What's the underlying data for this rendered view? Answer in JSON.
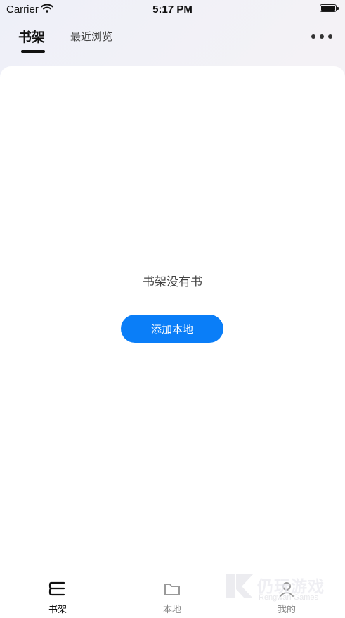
{
  "status_bar": {
    "carrier": "Carrier",
    "time": "5:17 PM"
  },
  "header": {
    "tabs": [
      {
        "label": "书架",
        "active": true
      },
      {
        "label": "最近浏览",
        "active": false
      }
    ],
    "more_icon": "more-horizontal-icon"
  },
  "main": {
    "empty_message": "书架没有书",
    "add_button_label": "添加本地",
    "accent_color": "#0a7ef8"
  },
  "bottom_nav": {
    "items": [
      {
        "label": "书架",
        "icon": "bookshelf-icon",
        "active": true
      },
      {
        "label": "本地",
        "icon": "folder-icon",
        "active": false
      },
      {
        "label": "我的",
        "icon": "profile-icon",
        "active": false
      }
    ]
  },
  "watermark": {
    "title": "仍玩游戏",
    "subtitle": "Rengwan Games"
  }
}
